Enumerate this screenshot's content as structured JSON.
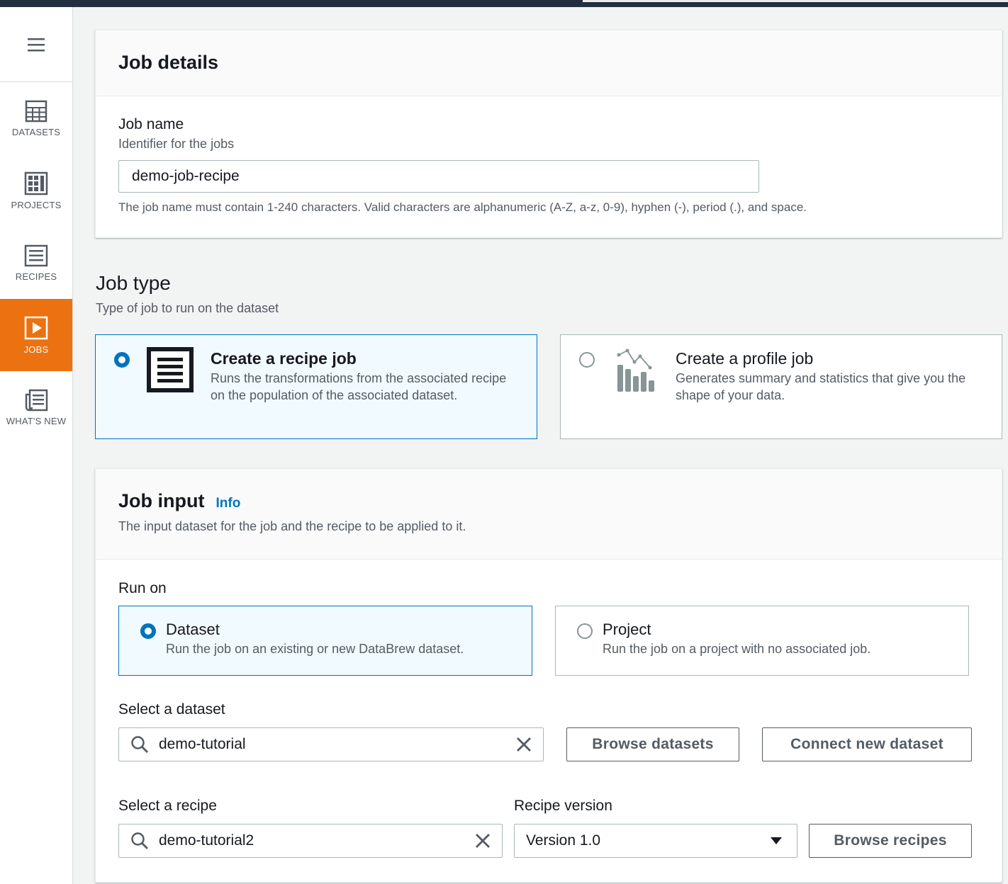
{
  "sidebar": {
    "menu_icon": "hamburger-icon",
    "items": [
      {
        "label": "DATASETS",
        "icon": "grid-icon",
        "active": false
      },
      {
        "label": "PROJECTS",
        "icon": "projects-grid-icon",
        "active": false
      },
      {
        "label": "RECIPES",
        "icon": "list-icon",
        "active": false
      },
      {
        "label": "JOBS",
        "icon": "play-icon",
        "active": true
      },
      {
        "label": "WHAT'S NEW",
        "icon": "newspaper-icon",
        "active": false
      }
    ]
  },
  "job_details": {
    "title": "Job details",
    "job_name_label": "Job name",
    "job_name_desc": "Identifier for the jobs",
    "job_name_value": "demo-job-recipe",
    "job_name_hint": "The job name must contain 1-240 characters. Valid characters are alphanumeric (A-Z, a-z, 0-9), hyphen (-), period (.), and space."
  },
  "job_type": {
    "title": "Job type",
    "desc": "Type of job to run on the dataset",
    "options": [
      {
        "title": "Create a recipe job",
        "desc": "Runs the transformations from the associated recipe on the population of the associated dataset.",
        "selected": true,
        "icon": "recipe-icon"
      },
      {
        "title": "Create a profile job",
        "desc": "Generates summary and statistics that give you the shape of your data.",
        "selected": false,
        "icon": "profile-chart-icon"
      }
    ]
  },
  "job_input": {
    "title": "Job input",
    "info_link": "Info",
    "desc": "The input dataset for the job and the recipe to be applied to it.",
    "run_on_label": "Run on",
    "run_on_options": [
      {
        "title": "Dataset",
        "desc": "Run the job on an existing or new DataBrew dataset.",
        "selected": true
      },
      {
        "title": "Project",
        "desc": "Run the job on a project with no associated job.",
        "selected": false
      }
    ],
    "dataset_label": "Select a dataset",
    "dataset_value": "demo-tutorial",
    "browse_datasets": "Browse datasets",
    "connect_dataset": "Connect new dataset",
    "recipe_label": "Select a recipe",
    "recipe_value": "demo-tutorial2",
    "recipe_version_label": "Recipe version",
    "recipe_version_value": "Version 1.0",
    "browse_recipes": "Browse recipes"
  },
  "colors": {
    "accent": "#0073bb",
    "active_nav": "#ec7211"
  }
}
